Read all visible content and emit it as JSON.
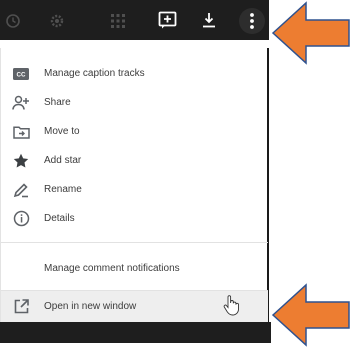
{
  "toolbar": {
    "icons": [
      "history-icon",
      "settings-icon",
      "grid-icon",
      "add-comment-icon",
      "download-icon",
      "more-vert-icon"
    ]
  },
  "menu": {
    "items": [
      {
        "label": "Manage caption tracks",
        "icon": "closed-caption-icon"
      },
      {
        "label": "Share",
        "icon": "add-person-icon"
      },
      {
        "label": "Move to",
        "icon": "move-to-folder-icon"
      },
      {
        "label": "Add star",
        "icon": "star-icon"
      },
      {
        "label": "Rename",
        "icon": "pencil-icon"
      },
      {
        "label": "Details",
        "icon": "info-icon"
      }
    ],
    "comment_notifications": "Manage comment notifications",
    "open_new_window": "Open in new window"
  },
  "colors": {
    "toolbar_bg": "#1e1e1e",
    "arrow_fill": "#ed7d31",
    "arrow_stroke": "#2f528f",
    "icon_gray": "#5f6368"
  }
}
